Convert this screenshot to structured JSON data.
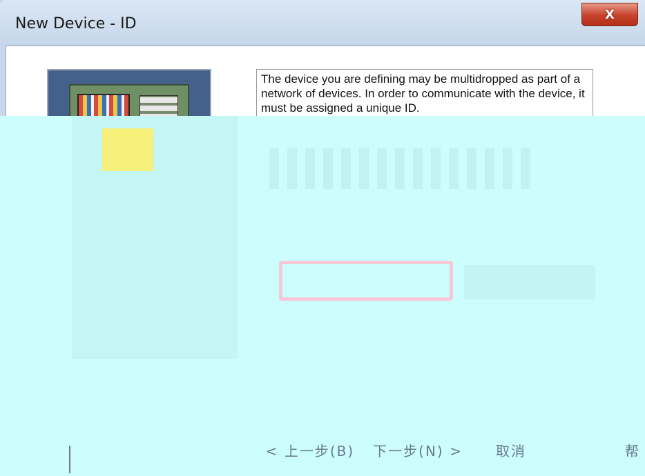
{
  "window": {
    "title": "New Device - ID",
    "close_label": "X"
  },
  "wizard": {
    "description": "The device you are defining may be multidropped as part of a network of devices.  In order to communicate with the device, it must be assigned a unique ID.",
    "device_id_value": ""
  },
  "buttons": {
    "back_label": "< 上一步(B)",
    "next_label": "下一步(N) >",
    "cancel_label": "取消",
    "help_label": "帮"
  }
}
